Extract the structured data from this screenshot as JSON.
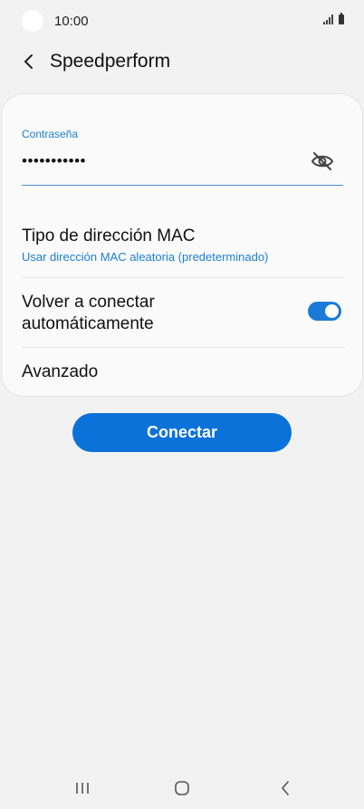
{
  "status_bar": {
    "time": "10:00"
  },
  "header": {
    "title": "Speedperform"
  },
  "password": {
    "label": "Contraseña",
    "value": "•••••••••••"
  },
  "mac": {
    "title": "Tipo de dirección MAC",
    "subtitle": "Usar dirección MAC aleatoria (predeterminado)"
  },
  "reconnect": {
    "label": "Volver a conectar automáticamente",
    "enabled": true
  },
  "advanced": {
    "label": "Avanzado"
  },
  "connect_button": {
    "label": "Conectar"
  },
  "colors": {
    "accent": "#0b72d9",
    "link": "#1a7fd4",
    "background": "#f2f2f2",
    "card": "#fafafa"
  },
  "icons": [
    "back-arrow-icon",
    "eye-off-icon",
    "recent-apps-icon",
    "home-icon",
    "nav-back-icon",
    "signal-icon",
    "battery-icon"
  ]
}
